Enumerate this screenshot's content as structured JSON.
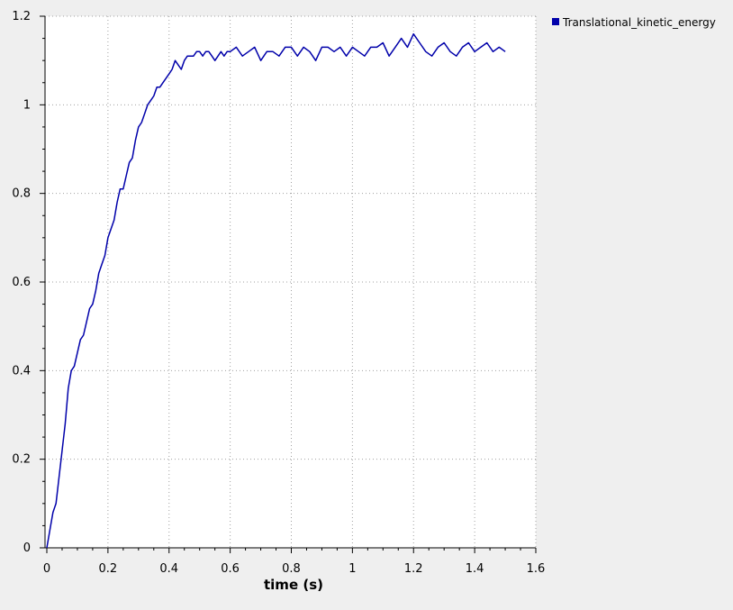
{
  "colors": {
    "background": "#efefef",
    "plot_background": "#ffffff",
    "series": "#0000aa",
    "grid": "#a0a0a0"
  },
  "chart_data": {
    "type": "line",
    "title": "",
    "xlabel": "time (s)",
    "ylabel": "",
    "xlim": [
      0,
      1.6
    ],
    "ylim": [
      0,
      1.2
    ],
    "x_ticks": [
      0,
      0.2,
      0.4,
      0.6,
      0.8,
      1,
      1.2,
      1.4,
      1.6
    ],
    "y_ticks": [
      0,
      0.2,
      0.4,
      0.6,
      0.8,
      1,
      1.2
    ],
    "x_tick_labels": [
      "0",
      "0.2",
      "0.4",
      "0.6",
      "0.8",
      "1",
      "1.2",
      "1.4",
      "1.6"
    ],
    "y_tick_labels": [
      "0",
      "0.2",
      "0.4",
      "0.6",
      "0.8",
      "1",
      "1.2"
    ],
    "grid": true,
    "legend_position": "right, outside plot",
    "series": [
      {
        "name": "Translational_kinetic_energy",
        "color": "#0000aa",
        "x": [
          0,
          0.01,
          0.02,
          0.03,
          0.04,
          0.05,
          0.06,
          0.07,
          0.08,
          0.09,
          0.1,
          0.11,
          0.12,
          0.13,
          0.14,
          0.15,
          0.16,
          0.17,
          0.18,
          0.19,
          0.2,
          0.21,
          0.22,
          0.23,
          0.24,
          0.25,
          0.26,
          0.27,
          0.28,
          0.29,
          0.3,
          0.31,
          0.32,
          0.33,
          0.34,
          0.35,
          0.36,
          0.37,
          0.38,
          0.39,
          0.4,
          0.41,
          0.42,
          0.43,
          0.44,
          0.45,
          0.46,
          0.47,
          0.48,
          0.49,
          0.5,
          0.51,
          0.52,
          0.53,
          0.54,
          0.55,
          0.56,
          0.57,
          0.58,
          0.59,
          0.6,
          0.62,
          0.64,
          0.66,
          0.68,
          0.7,
          0.72,
          0.74,
          0.76,
          0.78,
          0.8,
          0.82,
          0.84,
          0.86,
          0.88,
          0.9,
          0.92,
          0.94,
          0.96,
          0.98,
          1.0,
          1.02,
          1.04,
          1.06,
          1.08,
          1.1,
          1.12,
          1.14,
          1.16,
          1.18,
          1.2,
          1.22,
          1.24,
          1.26,
          1.28,
          1.3,
          1.32,
          1.34,
          1.36,
          1.38,
          1.4,
          1.42,
          1.44,
          1.46,
          1.48,
          1.5
        ],
        "values": [
          0,
          0.04,
          0.08,
          0.1,
          0.16,
          0.22,
          0.28,
          0.36,
          0.4,
          0.41,
          0.44,
          0.47,
          0.48,
          0.51,
          0.54,
          0.55,
          0.58,
          0.62,
          0.64,
          0.66,
          0.7,
          0.72,
          0.74,
          0.78,
          0.81,
          0.81,
          0.84,
          0.87,
          0.88,
          0.92,
          0.95,
          0.96,
          0.98,
          1.0,
          1.01,
          1.02,
          1.04,
          1.04,
          1.05,
          1.06,
          1.07,
          1.08,
          1.1,
          1.09,
          1.08,
          1.1,
          1.11,
          1.11,
          1.11,
          1.12,
          1.12,
          1.11,
          1.12,
          1.12,
          1.11,
          1.1,
          1.11,
          1.12,
          1.11,
          1.12,
          1.12,
          1.13,
          1.11,
          1.12,
          1.13,
          1.1,
          1.12,
          1.12,
          1.11,
          1.13,
          1.13,
          1.11,
          1.13,
          1.12,
          1.1,
          1.13,
          1.13,
          1.12,
          1.13,
          1.11,
          1.13,
          1.12,
          1.11,
          1.13,
          1.13,
          1.14,
          1.11,
          1.13,
          1.15,
          1.13,
          1.16,
          1.14,
          1.12,
          1.11,
          1.13,
          1.14,
          1.12,
          1.11,
          1.13,
          1.14,
          1.12,
          1.13,
          1.14,
          1.12,
          1.13,
          1.12
        ]
      }
    ]
  }
}
